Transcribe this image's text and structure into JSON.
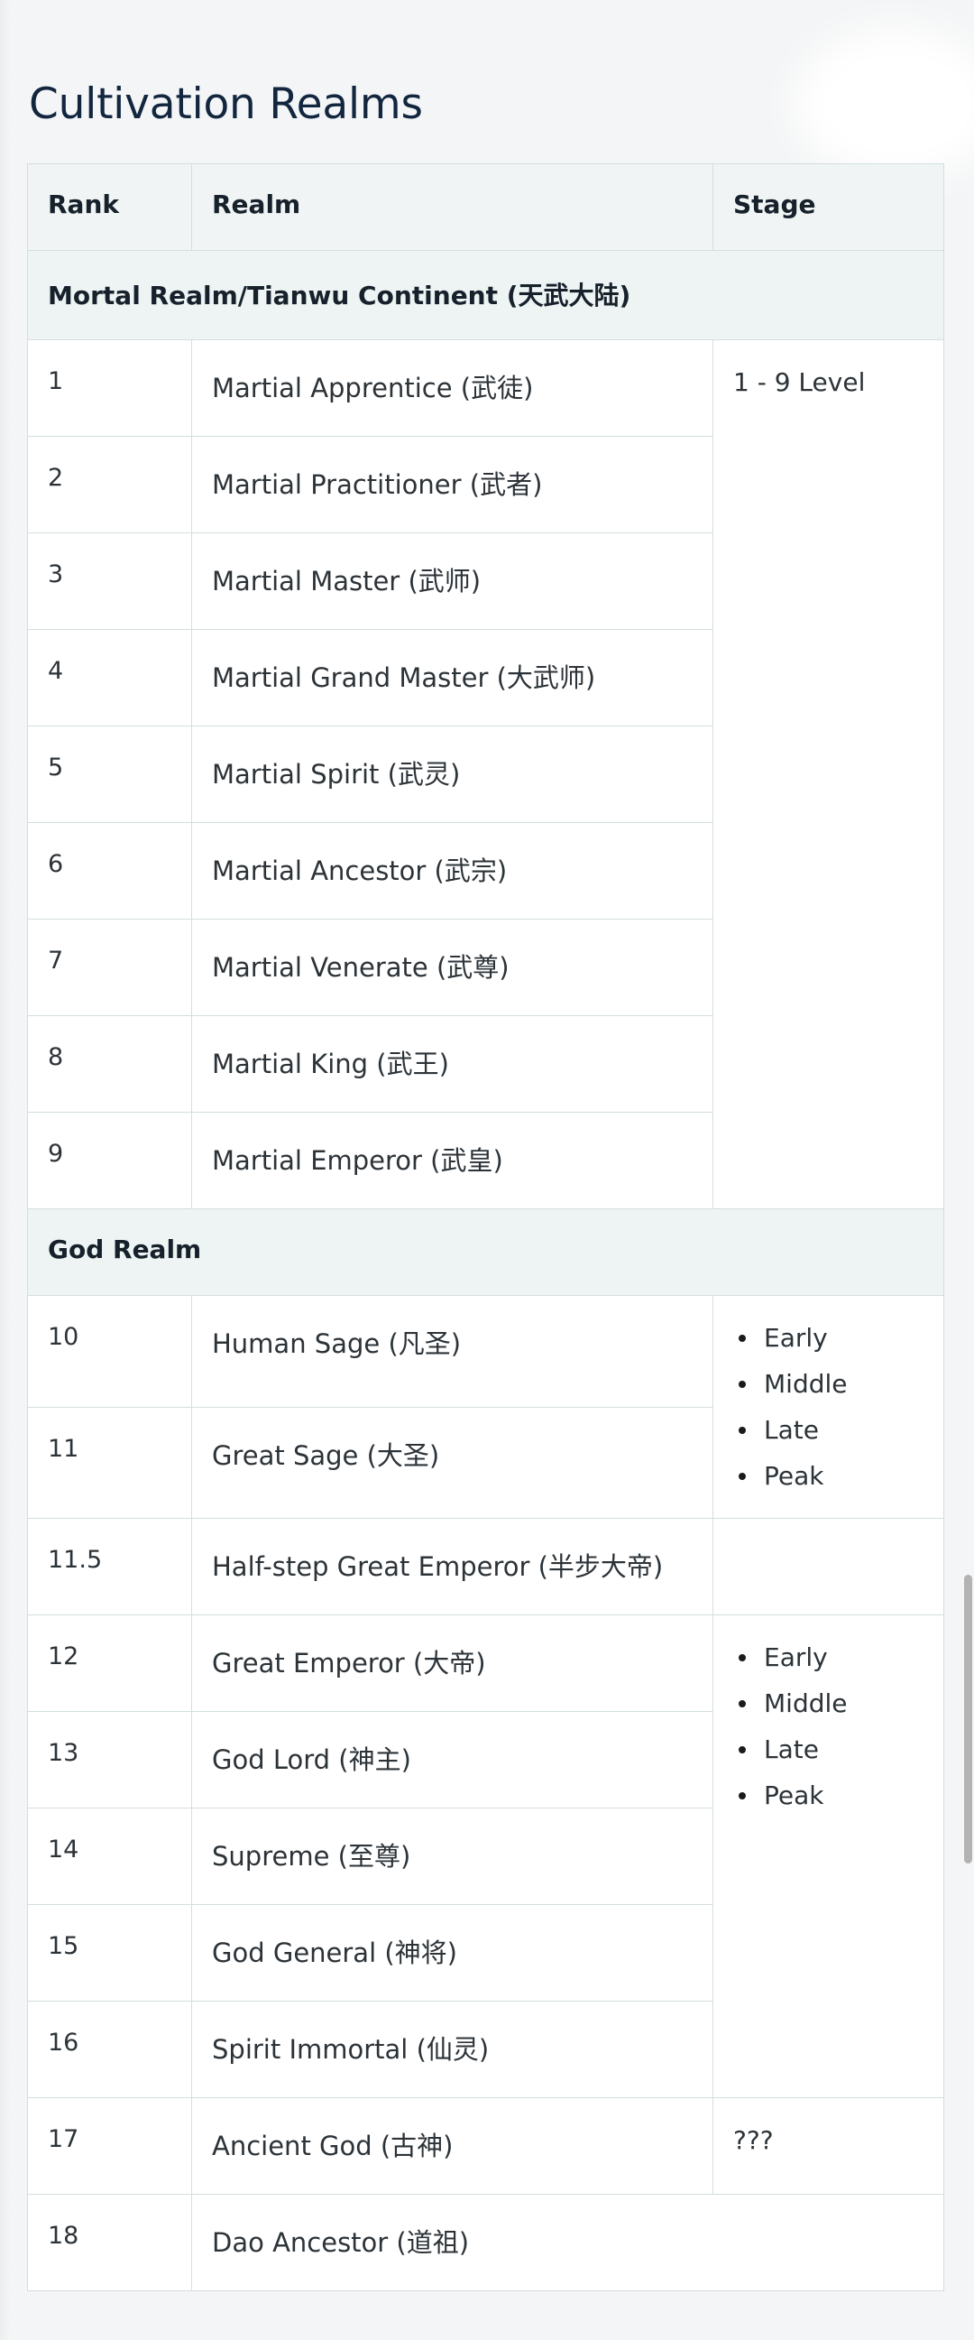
{
  "page": {
    "title": "Cultivation Realms"
  },
  "table": {
    "columns": [
      "Rank",
      "Realm",
      "Stage"
    ],
    "sections": [
      {
        "header": "Mortal Realm/Tianwu Continent (天武大陆)",
        "stage_label": "1 - 9 Level",
        "stage_bullets": [],
        "rows": [
          {
            "rank": "1",
            "realm": "Martial Apprentice (武徒)"
          },
          {
            "rank": "2",
            "realm": "Martial Practitioner (武者)"
          },
          {
            "rank": "3",
            "realm": "Martial Master (武师)"
          },
          {
            "rank": "4",
            "realm": "Martial Grand Master (大武师)"
          },
          {
            "rank": "5",
            "realm": "Martial Spirit (武灵)"
          },
          {
            "rank": "6",
            "realm": "Martial Ancestor (武宗)"
          },
          {
            "rank": "7",
            "realm": "Martial Venerate (武尊)"
          },
          {
            "rank": "8",
            "realm": "Martial King (武王)"
          },
          {
            "rank": "9",
            "realm": "Martial Emperor (武皇)"
          }
        ]
      },
      {
        "header": "God Realm",
        "groups": [
          {
            "stage_bullets": [
              "Early",
              "Middle",
              "Late",
              "Peak"
            ],
            "rows": [
              {
                "rank": "10",
                "realm": "Human Sage (凡圣)"
              },
              {
                "rank": "11",
                "realm": "Great Sage (大圣)"
              }
            ]
          },
          {
            "stage_bullets": [],
            "stage_label": "",
            "rows": [
              {
                "rank": "11.5",
                "realm": "Half-step Great Emperor (半步大帝)"
              }
            ]
          },
          {
            "stage_bullets": [
              "Early",
              "Middle",
              "Late",
              "Peak"
            ],
            "rows": [
              {
                "rank": "12",
                "realm": "Great Emperor (大帝)"
              },
              {
                "rank": "13",
                "realm": "God Lord (神主)"
              },
              {
                "rank": "14",
                "realm": "Supreme (至尊)"
              },
              {
                "rank": "15",
                "realm": "God General (神将)"
              },
              {
                "rank": "16",
                "realm": "Spirit Immortal (仙灵)"
              }
            ]
          },
          {
            "stage_label": "???",
            "stage_bullets": [],
            "rows": [
              {
                "rank": "17",
                "realm": "Ancient God (古神)"
              }
            ]
          },
          {
            "stage_label": "",
            "stage_bullets": [],
            "rows": [
              {
                "rank": "18",
                "realm": "Dao Ancestor (道祖)"
              }
            ]
          }
        ]
      }
    ]
  },
  "colors": {
    "page_background": "#f4f5f6",
    "title": "#12263f",
    "table_background": "#ffffff",
    "header_background": "#f1f4f4",
    "section_background": "#eef3f3",
    "border": "#d4dede",
    "text": "#2c3338",
    "scrollbar_thumb": "#b3b3b3"
  }
}
